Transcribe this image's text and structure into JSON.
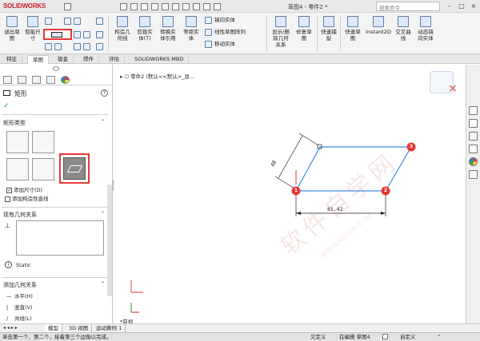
{
  "app": {
    "logo": "SOLIDWORKS",
    "doc_title": "草图4 - 零件2 *",
    "search_placeholder": "搜索命令",
    "logo_color": "#cc1f2b"
  },
  "ribbon": {
    "exit_sketch": "退出草\n图",
    "smart_dim": "智能尺\n寸",
    "trim": "剪裁实\n体(T)",
    "convert": "转换实\n体引用",
    "offset": "等距实\n体",
    "construct": "构造几\n何线",
    "mirror": "镜向实体",
    "linear_pattern": "线性草图阵列",
    "move": "移动实体",
    "show_relations": "显示/删\n除几何\n关系",
    "repair": "修复草\n图",
    "quick_snap": "快速捕\n捉",
    "quick_sketch": "快速草\n图",
    "instant2d": "Instant2D",
    "intersect_curve": "交叉曲\n线",
    "dynamic_mirror": "动态镜\n向实体"
  },
  "tabs": [
    "特征",
    "草图",
    "钣金",
    "焊件",
    "评估",
    "SOLIDWORKS MBD"
  ],
  "active_tab": 1,
  "left_panel": {
    "title": "矩形",
    "section_rect_type": "矩形类型",
    "add_dimension": "添加尺寸(D)",
    "add_construction": "添加构造性直线",
    "section_existing": "现有几何关系",
    "static_label": "Static",
    "section_add_relation": "添加几何关系",
    "relations": [
      "水平(H)",
      "竖直(V)",
      "共线(L)"
    ]
  },
  "canvas": {
    "breadcrumb": "零件2 (默认<<默认>_显...",
    "view_label": "*前视",
    "dim_horizontal": "81.42",
    "dim_angled": "48",
    "point_labels": [
      "1",
      "2",
      "3"
    ]
  },
  "watermark": {
    "main": "软件自学网",
    "sub": "WWW.RJZXW.COM"
  },
  "bottom_tabs": [
    "模型",
    "3D 视图",
    "运动算例 1"
  ],
  "status": {
    "hint": "单击第一个、第二个，接着第三个边角以完成。",
    "state": "欠定义",
    "editing": "在编辑 草图4",
    "custom": "自定义"
  },
  "colors": {
    "sketch_line": "#3a8ee6",
    "point_red": "#e53935",
    "highlight_box": "#e53935"
  }
}
